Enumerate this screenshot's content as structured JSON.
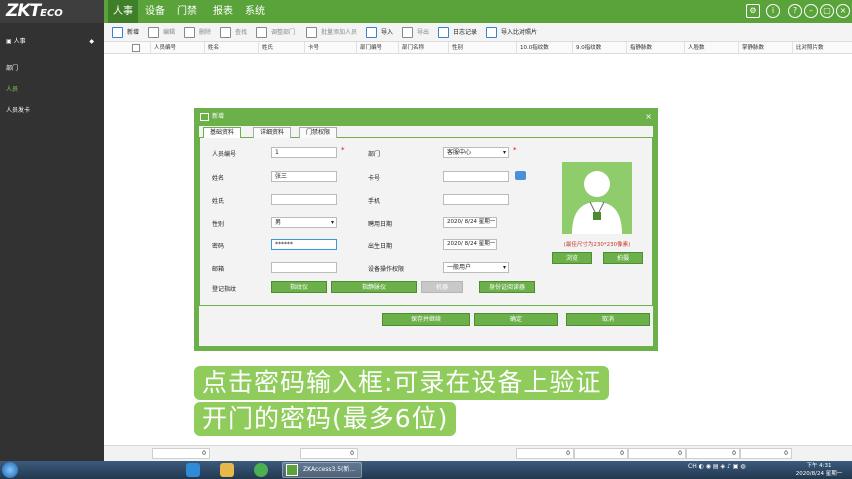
{
  "app": {
    "logo_main": "ZKT",
    "logo_sub": "ECO",
    "menus": [
      "人事",
      "设备",
      "门禁",
      "报表",
      "系统"
    ],
    "active_menu": "人事"
  },
  "window_controls": [
    "gear-icon",
    "info-icon",
    "help-icon",
    "minimize-icon",
    "maximize-icon",
    "close-icon"
  ],
  "toolbar": {
    "items": [
      {
        "label": "新增",
        "icon": "add-person-icon",
        "enabled": true
      },
      {
        "label": "编辑",
        "icon": "edit-icon",
        "enabled": false
      },
      {
        "label": "删除",
        "icon": "delete-icon",
        "enabled": false
      },
      {
        "label": "查找",
        "icon": "search-icon",
        "enabled": false
      },
      {
        "label": "调整部门",
        "icon": "adjust-dept-icon",
        "enabled": false
      },
      {
        "label": "批量添加人员",
        "icon": "batch-add-icon",
        "enabled": false
      },
      {
        "label": "导入",
        "icon": "import-icon",
        "enabled": true
      },
      {
        "label": "导出",
        "icon": "export-icon",
        "enabled": false
      },
      {
        "label": "日志记录",
        "icon": "log-icon",
        "enabled": true
      },
      {
        "label": "导入比对照片",
        "icon": "import-photo-icon",
        "enabled": true
      }
    ]
  },
  "sidebar": {
    "header": "人事",
    "header_arrow": "◆",
    "items": [
      {
        "label": "部门",
        "active": false
      },
      {
        "label": "人员",
        "active": true
      },
      {
        "label": "人员发卡",
        "active": false
      }
    ]
  },
  "table": {
    "columns": [
      "人员编号",
      "姓名",
      "姓氏",
      "卡号",
      "部门编号",
      "部门名称",
      "性别",
      "10.0指纹数",
      "9.0指纹数",
      "指静脉数",
      "人脸数",
      "掌静脉数",
      "比对照片数"
    ]
  },
  "footer": {
    "values": [
      "0",
      "0",
      "0",
      "0",
      "0",
      "0",
      "0"
    ]
  },
  "dialog": {
    "title": "新增",
    "close": "×",
    "tabs": [
      "基础资料",
      "详细资料",
      "门禁权限"
    ],
    "active_tab": "基础资料",
    "fields": {
      "person_id": {
        "label": "人员编号",
        "value": "1",
        "required": "*"
      },
      "department": {
        "label": "部门",
        "value": "客服中心",
        "required": "*"
      },
      "name": {
        "label": "姓名",
        "value": "张三"
      },
      "card_no": {
        "label": "卡号",
        "value": ""
      },
      "surname": {
        "label": "姓氏",
        "value": ""
      },
      "mobile": {
        "label": "手机",
        "value": ""
      },
      "gender": {
        "label": "性别",
        "value": "男"
      },
      "hire_date": {
        "label": "聘用日期",
        "value": "2020/ 8/24 星期一"
      },
      "password": {
        "label": "密码",
        "value": "******"
      },
      "birth_date": {
        "label": "出生日期",
        "value": "2020/ 8/24 星期一"
      },
      "email": {
        "label": "邮箱",
        "value": ""
      },
      "device_permission": {
        "label": "设备操作权限",
        "value": "一般用户"
      },
      "enroll_fp": {
        "label": "登记指纹"
      }
    },
    "enroll_buttons": [
      {
        "label": "指纹仪",
        "enabled": true
      },
      {
        "label": "指静脉仪",
        "enabled": true
      },
      {
        "label": "机器",
        "enabled": false
      },
      {
        "label": "身份证阅读器",
        "enabled": true
      }
    ],
    "photo": {
      "note": "(最佳尺寸为230*230像素)",
      "browse": "浏览",
      "capture": "拍摄"
    },
    "bottom_buttons": [
      "保存并继续",
      "确定",
      "取消"
    ]
  },
  "caption": {
    "line1": "点击密码输入框:可录在设备上验证",
    "line2": "开门的密码(最多6位)"
  },
  "taskbar": {
    "task_label": "ZKAccess3.5(新...",
    "tray_text": "CH",
    "clock_time": "下午 4:31",
    "clock_date": "2020/8/24 星期一"
  }
}
